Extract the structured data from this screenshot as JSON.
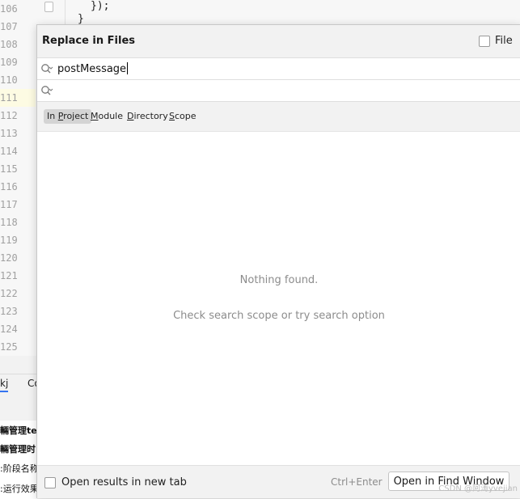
{
  "editor": {
    "line_numbers": [
      "106",
      "107",
      "108",
      "109",
      "110",
      "111",
      "112",
      "113",
      "114",
      "115",
      "116",
      "117",
      "118",
      "119",
      "120",
      "121",
      "122",
      "123",
      "124",
      "125"
    ],
    "active_line": "111",
    "code_line_1": "});",
    "code_line_2": "}"
  },
  "bottom_panel": {
    "tabs": [
      "kj",
      "Co"
    ],
    "log_lines": [
      "輛管理te",
      "輛管理时",
      ":阶段名称",
      ":运行效果"
    ]
  },
  "dialog": {
    "title": "Replace in Files",
    "file_mask_label": "File",
    "find_value": "postMessage",
    "replace_value": "",
    "scopes": [
      {
        "prefix": "In ",
        "mnemonic": "P",
        "rest": "roject",
        "selected": true
      },
      {
        "prefix": "",
        "mnemonic": "M",
        "rest": "odule",
        "selected": false
      },
      {
        "prefix": "",
        "mnemonic": "D",
        "rest": "irectory",
        "selected": false
      },
      {
        "prefix": "",
        "mnemonic": "S",
        "rest": "cope",
        "selected": false
      }
    ],
    "nothing_found": "Nothing found.",
    "hint": "Check search scope or try search option",
    "open_new_tab_label": "Open results in new tab",
    "shortcut": "Ctrl+Enter",
    "open_button_label": "Open in Find Window"
  },
  "watermark": "CSDN @阿涛yvejian",
  "icons": {
    "search": "search-history-icon",
    "fold": "fold-marker-icon"
  }
}
